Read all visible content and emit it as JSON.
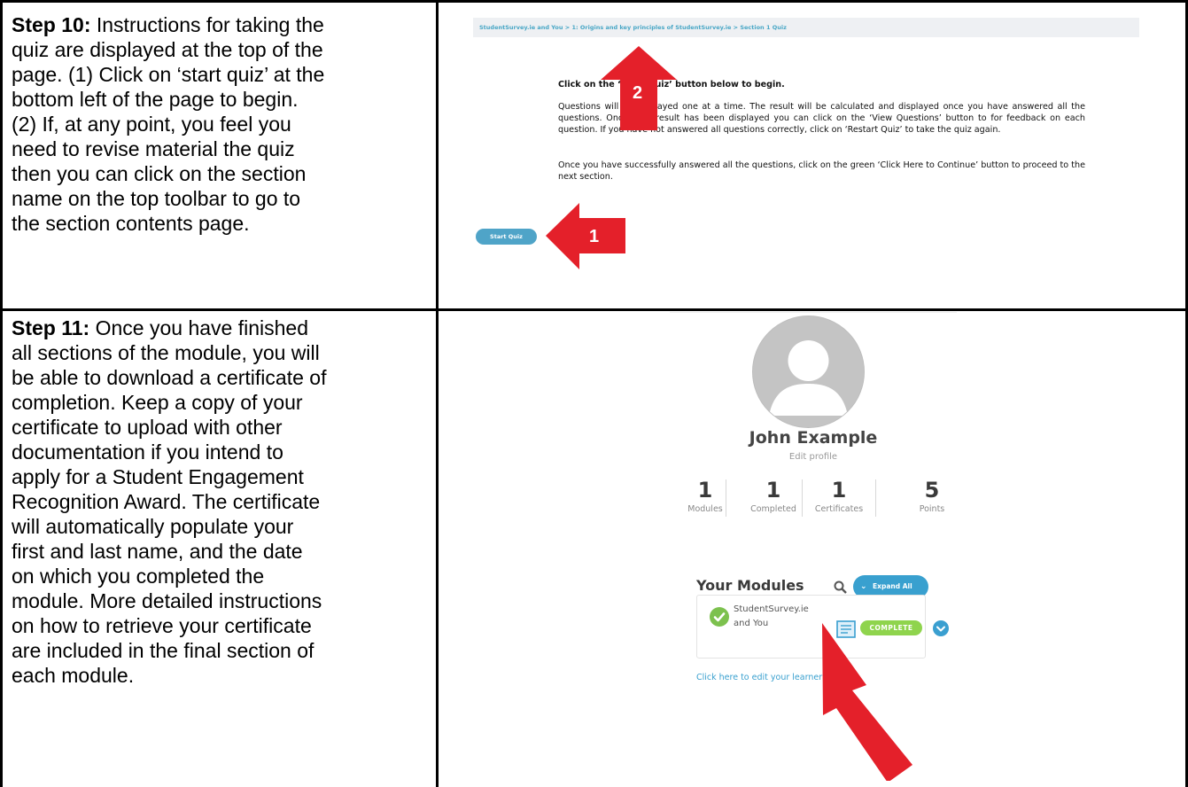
{
  "steps": [
    {
      "heading": "Step 10:",
      "lines": [
        " Instructions for taking the",
        "quiz are displayed at the top of the",
        "page. (1) Click on ‘start quiz’ at the",
        "bottom left of the page to begin.",
        "(2) If, at any point, you feel you",
        "need to revise material the quiz",
        "then you can click on the section",
        "name on the top toolbar to go to",
        "the section contents page."
      ]
    },
    {
      "heading": "Step 11:",
      "lines": [
        " Once you have finished",
        "all sections of the module, you will",
        "be able to download a certificate of",
        "completion.  Keep a copy of your",
        "certificate to upload with other",
        "documentation if you intend to",
        "apply for a Student Engagement",
        "Recognition Award.  The certificate",
        "will automatically populate your",
        "first and last name, and the date",
        "on which you completed the",
        "module.  More detailed instructions",
        "on how to retrieve your certificate",
        "are included in the final section of",
        "each module."
      ]
    }
  ],
  "quiz_page": {
    "breadcrumb": "StudentSurvey.ie and You > 1: Origins and key principles of StudentSurvey.ie > Section 1 Quiz",
    "intro": "Click on the ‘Start Quiz’ button below to begin.",
    "paragraph1": "Questions will be displayed one at a time.  The result will be calculated and displayed once you have answered all the questions. Once your result has been displayed you can click on the ‘View Questions’ button to for feedback on each question.  If you have not answered all questions correctly, click on ‘Restart Quiz’ to take the quiz again.",
    "paragraph2": "Once you have successfully answered all the questions, click on the green ‘Click Here to Continue’ button to proceed to the next section.",
    "start_button": "Start Quiz",
    "callouts": [
      "1",
      "2"
    ]
  },
  "profile_page": {
    "name": "John Example",
    "edit_profile": "Edit profile",
    "stats": [
      {
        "value": "1",
        "label": "Modules"
      },
      {
        "value": "1",
        "label": "Completed"
      },
      {
        "value": "1",
        "label": "Certificates"
      },
      {
        "value": "5",
        "label": "Points"
      }
    ],
    "modules_title": "Your Modules",
    "expand_all": "Expand All",
    "module": {
      "name_line1": "StudentSurvey.ie",
      "name_line2": "and You",
      "status": "COMPLETE"
    },
    "edit_learner_link": "Click here to edit your learner profile"
  },
  "colors": {
    "accent_blue": "#39a0cf",
    "complete_green": "#8fd44d",
    "callout_red": "#e4202a"
  },
  "icons": [
    "search-icon",
    "chevron-down-icon",
    "check-circle-icon",
    "certificate-icon",
    "avatar-icon"
  ]
}
